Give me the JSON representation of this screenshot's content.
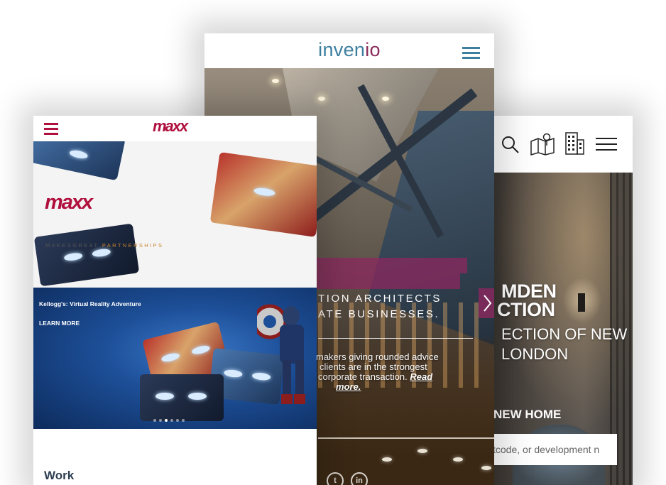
{
  "right_phone": {
    "title_lines": [
      "MDEN",
      "CTION"
    ],
    "subtitle_lines": [
      "ECTION OF NEW",
      "LONDON"
    ],
    "cta": "NEW HOME",
    "search_placeholder": "tcode, or development n",
    "icons": [
      "search-icon",
      "map-pin-icon",
      "building-icon",
      "hamburger-menu-icon"
    ]
  },
  "center_phone": {
    "logo_text": "inven",
    "logo_accent": "io",
    "headline_lines": [
      "TION ARCHITECTS",
      "ATE BUSINESSES."
    ],
    "body_lines": [
      "makers giving rounded advice",
      "clients are in the strongest",
      "corporate transaction."
    ],
    "read_more_part1": "Read",
    "read_more_part2": "more.",
    "social": [
      {
        "name": "twitter-icon",
        "glyph": "t"
      },
      {
        "name": "linkedin-icon",
        "glyph": "in"
      }
    ],
    "colors": {
      "brand_blue": "#3e7fa0",
      "brand_purple": "#8b2a5a"
    }
  },
  "left_phone": {
    "header_logo": "maxx",
    "banner1": {
      "logo": "maxx",
      "tagline_main": "MAKESGREAT ",
      "tagline_accent": "PARTNERSHIPS"
    },
    "banner2": {
      "title": "Kellogg's: Virtual Reality Adventure",
      "link": "LEARN MORE",
      "slide_count": 6,
      "active_slide": 3
    },
    "section_title": "Work",
    "colors": {
      "brand_red": "#b0103e",
      "tagline_orange": "#c9852e"
    }
  }
}
